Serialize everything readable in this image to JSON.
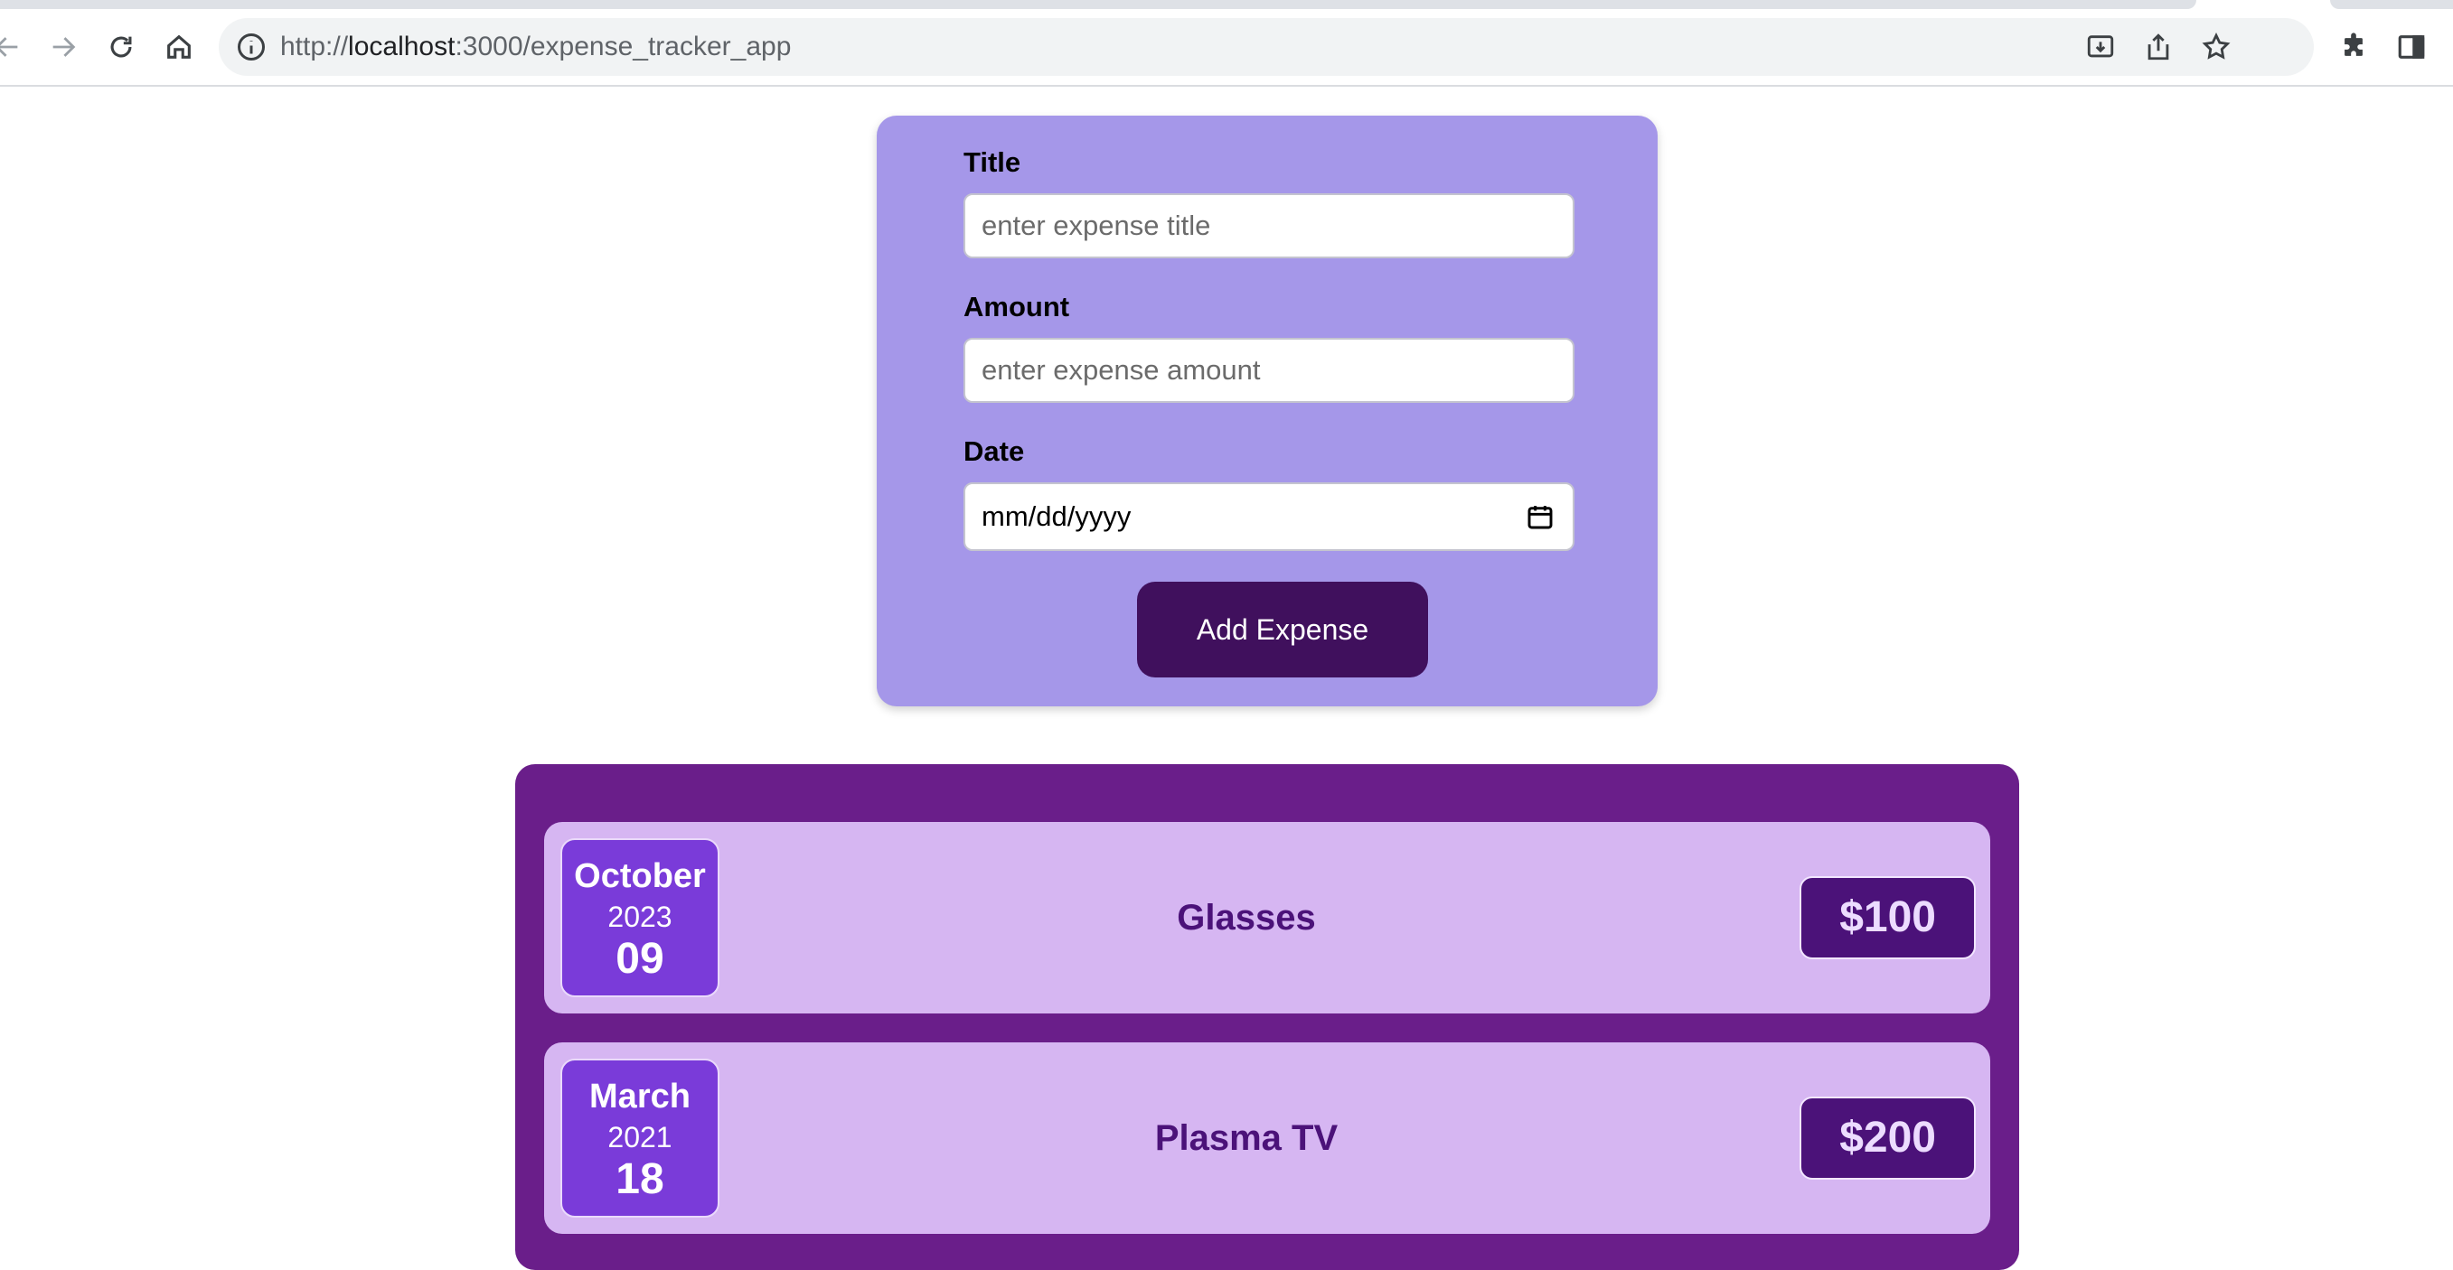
{
  "browser": {
    "url_scheme": "http://",
    "url_host": "localhost",
    "url_path": ":3000/expense_tracker_app"
  },
  "form": {
    "title_label": "Title",
    "title_placeholder": "enter expense title",
    "amount_label": "Amount",
    "amount_placeholder": "enter expense amount",
    "date_label": "Date",
    "date_placeholder": "mm/dd/yyyy",
    "submit_label": "Add Expense"
  },
  "expenses": [
    {
      "month": "October",
      "year": "2023",
      "day": "09",
      "title": "Glasses",
      "amount": "$100"
    },
    {
      "month": "March",
      "year": "2021",
      "day": "18",
      "title": "Plasma TV",
      "amount": "$200"
    }
  ],
  "colors": {
    "form_background": "#a597e9",
    "button": "#40105d",
    "list_background": "#6a1e8a",
    "item_background": "#d6b6f2",
    "date_box": "#7a3bd9",
    "amount_badge": "#4b1279"
  }
}
